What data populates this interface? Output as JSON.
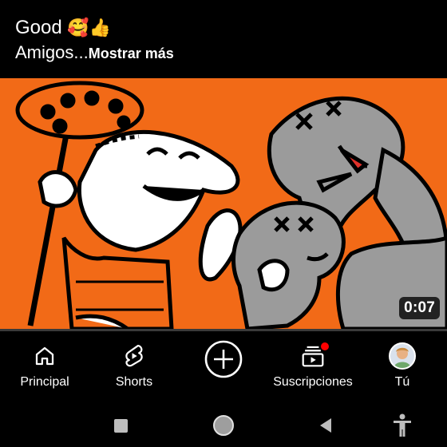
{
  "post": {
    "caption_line1": "Good",
    "caption_emojis": "🥰👍",
    "caption_line2": "Amigos...",
    "show_more": "Mostrar más"
  },
  "video": {
    "duration": "0:07",
    "progress": 0,
    "bg_color": "#f26a17"
  },
  "bottom_nav": {
    "items": [
      {
        "label": "Principal",
        "icon": "home-icon"
      },
      {
        "label": "Shorts",
        "icon": "shorts-icon"
      },
      {
        "label": "",
        "icon": "create-icon"
      },
      {
        "label": "Suscripciones",
        "icon": "subscriptions-icon",
        "notification": true
      },
      {
        "label": "Tú",
        "icon": "avatar"
      }
    ]
  },
  "system_nav": {
    "buttons": [
      "recents-icon",
      "home-circle-icon",
      "back-icon",
      "accessibility-icon"
    ]
  },
  "colors": {
    "accent_red": "#e62117",
    "notification": "#ff0000"
  }
}
